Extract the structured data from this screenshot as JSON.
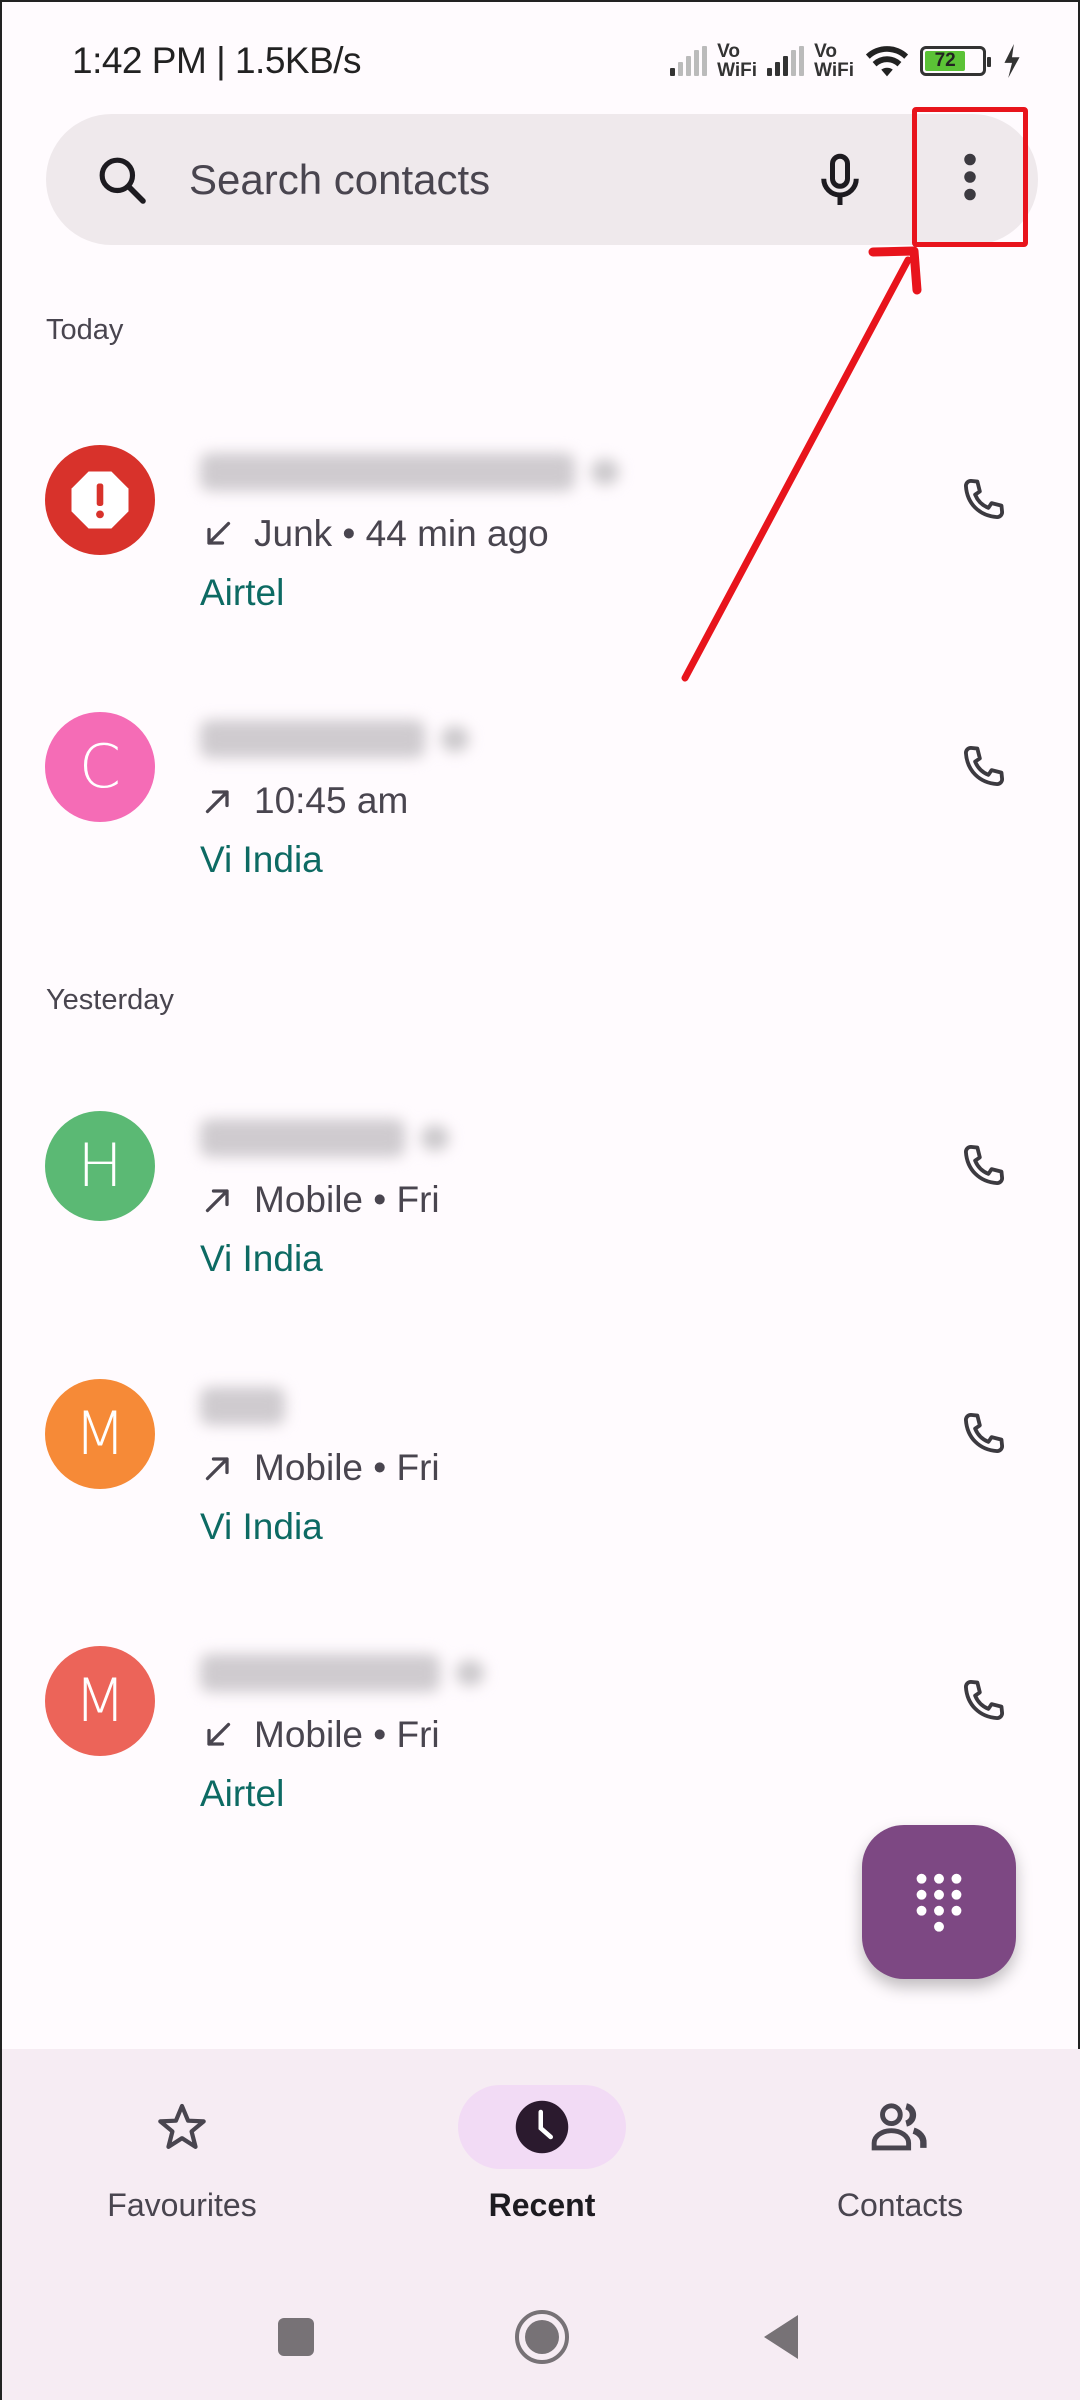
{
  "status_bar": {
    "time_speed": "1:42 PM | 1.5KB/s",
    "sim1_label": [
      "Vo",
      "WiFi"
    ],
    "sim2_label": [
      "Vo",
      "WiFi"
    ],
    "battery_level": "72",
    "battery_percent": 72,
    "charging": true,
    "colors": {
      "battery_fill": "#5bc236"
    }
  },
  "search": {
    "placeholder": "Search contacts",
    "value": "",
    "icons": [
      "search-icon",
      "mic-icon",
      "more-vert-icon"
    ]
  },
  "sections": [
    {
      "header": "Today",
      "calls": [
        {
          "avatar_type": "spam-icon",
          "avatar_letter": "",
          "avatar_color": "#d8322b",
          "name": "(blurred)",
          "direction": "incoming",
          "detail": "Junk • 44 min ago",
          "carrier": "Airtel"
        },
        {
          "avatar_type": "letter",
          "avatar_letter": "C",
          "avatar_color": "#f56cb6",
          "name": "(blurred)",
          "direction": "outgoing",
          "detail": "10:45 am",
          "carrier": "Vi India"
        }
      ]
    },
    {
      "header": "Yesterday",
      "calls": [
        {
          "avatar_type": "letter",
          "avatar_letter": "H",
          "avatar_color": "#5bb974",
          "name": "(blurred)",
          "direction": "outgoing",
          "detail": "Mobile • Fri",
          "carrier": "Vi India"
        },
        {
          "avatar_type": "letter",
          "avatar_letter": "M",
          "avatar_color": "#f68a37",
          "name": "(blurred)",
          "direction": "outgoing",
          "detail": "Mobile • Fri",
          "carrier": "Vi India"
        },
        {
          "avatar_type": "letter",
          "avatar_letter": "M",
          "avatar_color": "#ec6459",
          "name": "(blurred)",
          "direction": "incoming",
          "detail": "Mobile • Fri",
          "carrier": "Airtel"
        }
      ]
    }
  ],
  "fab": {
    "icon": "dialpad-icon",
    "color": "#7d4883"
  },
  "bottom_nav": {
    "items": [
      {
        "label": "Favourites",
        "icon": "star-icon",
        "active": false
      },
      {
        "label": "Recent",
        "icon": "clock-icon",
        "active": true
      },
      {
        "label": "Contacts",
        "icon": "people-icon",
        "active": false
      }
    ]
  },
  "system_nav": [
    "recents-button",
    "home-button",
    "back-button"
  ],
  "annotation": {
    "target": "more-options-button",
    "color": "#e8141c"
  }
}
